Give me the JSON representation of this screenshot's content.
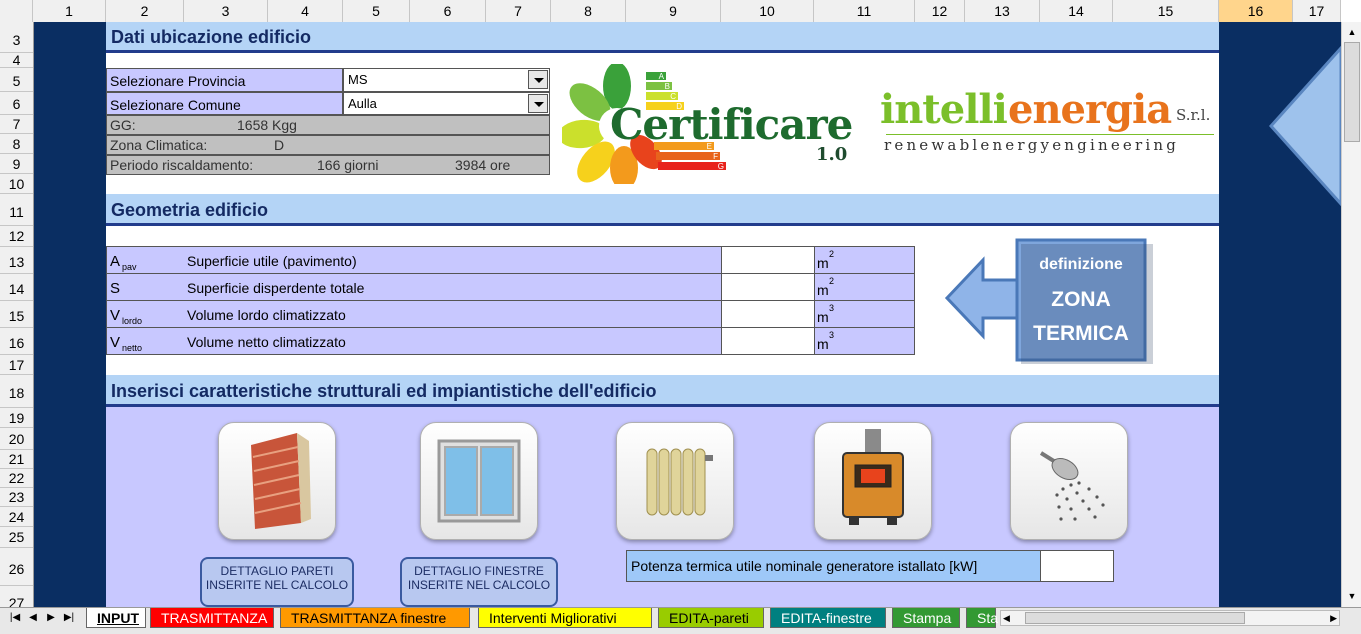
{
  "columns": [
    "1",
    "2",
    "3",
    "4",
    "5",
    "6",
    "7",
    "8",
    "9",
    "10",
    "11",
    "12",
    "13",
    "14",
    "15",
    "16",
    "17"
  ],
  "selected_column": "16",
  "rows": [
    "3",
    "4",
    "5",
    "6",
    "7",
    "8",
    "9",
    "10",
    "11",
    "12",
    "13",
    "14",
    "15",
    "16",
    "17",
    "18",
    "19",
    "20",
    "21",
    "22",
    "23",
    "24",
    "25",
    "26",
    "27"
  ],
  "section1": {
    "title": "Dati ubicazione edificio"
  },
  "location": {
    "provincia_label": "Selezionare Provincia",
    "provincia_value": "MS",
    "comune_label": "Selezionare Comune",
    "comune_value": "Aulla",
    "gg_label": "GG:",
    "gg_value": "1658 Kgg",
    "zona_label": "Zona Climatica:",
    "zona_value": "D",
    "periodo_label": "Periodo riscaldamento:",
    "periodo_giorni": "166 giorni",
    "periodo_ore": "3984 ore"
  },
  "logos": {
    "certificare": "Certificare",
    "certificare_version": "1.0",
    "energy_classes": [
      "A",
      "B",
      "C",
      "D",
      "E",
      "F",
      "G"
    ],
    "intellienergia_part1": "intelli",
    "intellienergia_part2": "energia",
    "intellienergia_suffix": "S.r.l.",
    "intellienergia_tagline": "renewablenergyengineering"
  },
  "section2": {
    "title": "Geometria edificio"
  },
  "geometry": [
    {
      "symbol": "A",
      "sub": "pav",
      "desc": "Superficie utile (pavimento)",
      "value": "",
      "unit": "m",
      "exp": "2"
    },
    {
      "symbol": "S",
      "sub": "",
      "desc": "Superficie disperdente totale",
      "value": "",
      "unit": "m",
      "exp": "2"
    },
    {
      "symbol": "V",
      "sub": "lordo",
      "desc": "Volume lordo climatizzato",
      "value": "",
      "unit": "m",
      "exp": "3"
    },
    {
      "symbol": "V",
      "sub": "netto",
      "desc": "Volume netto climatizzato",
      "value": "",
      "unit": "m",
      "exp": "3"
    }
  ],
  "zona_button": {
    "line1": "definizione",
    "line2": "ZONA",
    "line3": "TERMICA"
  },
  "section3": {
    "title": "Inserisci caratteristiche strutturali ed impiantistiche dell'edificio"
  },
  "buttons": {
    "pareti": "DETTAGLIO PARETI INSERITE NEL CALCOLO",
    "finestre": "DETTAGLIO FINESTRE INSERITE NEL CALCOLO"
  },
  "potenza": {
    "label": "Potenza termica utile nominale generatore istallato  [kW]",
    "value": ""
  },
  "tabs": [
    {
      "label": "INPUT",
      "bg": "#ffffff",
      "color": "#000000",
      "active": true
    },
    {
      "label": "TRASMITTANZA",
      "bg": "#ff0000",
      "color": "#ffffff"
    },
    {
      "label": "TRASMITTANZA finestre",
      "bg": "#ff9900",
      "color": "#000000"
    },
    {
      "label": "Interventi Migliorativi",
      "bg": "#ffff00",
      "color": "#000000"
    },
    {
      "label": "EDITA-pareti",
      "bg": "#99cc00",
      "color": "#000000"
    },
    {
      "label": "EDITA-finestre",
      "bg": "#008080",
      "color": "#ffffff"
    },
    {
      "label": "Stampa",
      "bg": "#339933",
      "color": "#ffffff"
    },
    {
      "label": "Sta",
      "bg": "#339933",
      "color": "#ffffff"
    }
  ],
  "colors": {
    "navy": "#0a2e62",
    "section_bg": "#b4d4f6",
    "lavender": "#c8c8ff"
  }
}
